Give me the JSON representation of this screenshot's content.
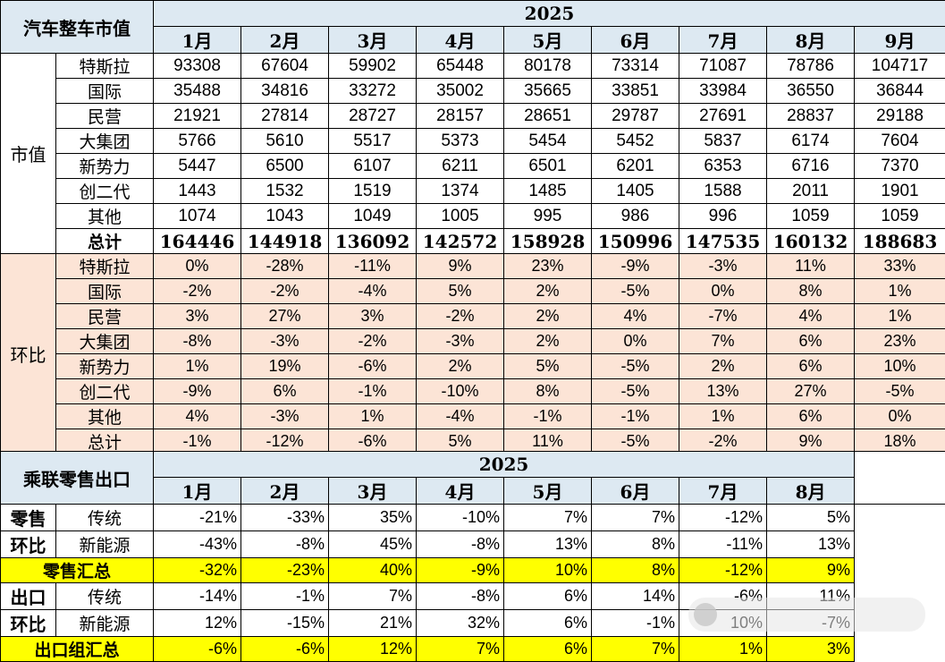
{
  "table1": {
    "title": "汽车整车市值",
    "year": "2025",
    "months": [
      "1月",
      "2月",
      "3月",
      "4月",
      "5月",
      "6月",
      "7月",
      "8月",
      "9月"
    ],
    "market_value": {
      "group_label": "市值",
      "rows": [
        {
          "label": "特斯拉",
          "values": [
            "93308",
            "67604",
            "59902",
            "65448",
            "80178",
            "73314",
            "71087",
            "78786",
            "104717"
          ]
        },
        {
          "label": "国际",
          "values": [
            "35488",
            "34816",
            "33272",
            "35002",
            "35665",
            "33851",
            "33984",
            "36550",
            "36844"
          ]
        },
        {
          "label": "民营",
          "values": [
            "21921",
            "27814",
            "28727",
            "28157",
            "28651",
            "29787",
            "27691",
            "28837",
            "29188"
          ]
        },
        {
          "label": "大集团",
          "values": [
            "5766",
            "5610",
            "5517",
            "5373",
            "5454",
            "5452",
            "5837",
            "6174",
            "7604"
          ]
        },
        {
          "label": "新势力",
          "values": [
            "5447",
            "6500",
            "6107",
            "6211",
            "6501",
            "6201",
            "6353",
            "6716",
            "7370"
          ]
        },
        {
          "label": "创二代",
          "values": [
            "1443",
            "1532",
            "1519",
            "1374",
            "1485",
            "1405",
            "1588",
            "2011",
            "1901"
          ]
        },
        {
          "label": "其他",
          "values": [
            "1074",
            "1043",
            "1049",
            "1005",
            "995",
            "986",
            "996",
            "1059",
            "1059"
          ]
        }
      ],
      "total": {
        "label": "总计",
        "values": [
          "164446",
          "144918",
          "136092",
          "142572",
          "158928",
          "150996",
          "147535",
          "160132",
          "188683"
        ]
      }
    },
    "mom": {
      "group_label": "环比",
      "rows": [
        {
          "label": "特斯拉",
          "values": [
            "0%",
            "-28%",
            "-11%",
            "9%",
            "23%",
            "-9%",
            "-3%",
            "11%",
            "33%"
          ]
        },
        {
          "label": "国际",
          "values": [
            "-2%",
            "-2%",
            "-4%",
            "5%",
            "2%",
            "-5%",
            "0%",
            "8%",
            "1%"
          ]
        },
        {
          "label": "民营",
          "values": [
            "3%",
            "27%",
            "3%",
            "-2%",
            "2%",
            "4%",
            "-7%",
            "4%",
            "1%"
          ]
        },
        {
          "label": "大集团",
          "values": [
            "-8%",
            "-3%",
            "-2%",
            "-3%",
            "2%",
            "0%",
            "7%",
            "6%",
            "23%"
          ]
        },
        {
          "label": "新势力",
          "values": [
            "1%",
            "19%",
            "-6%",
            "2%",
            "5%",
            "-5%",
            "2%",
            "6%",
            "10%"
          ]
        },
        {
          "label": "创二代",
          "values": [
            "-9%",
            "6%",
            "-1%",
            "-10%",
            "8%",
            "-5%",
            "13%",
            "27%",
            "-5%"
          ]
        },
        {
          "label": "其他",
          "values": [
            "4%",
            "-3%",
            "1%",
            "-4%",
            "-1%",
            "-1%",
            "1%",
            "6%",
            "0%"
          ]
        },
        {
          "label": "总计",
          "values": [
            "-1%",
            "-12%",
            "-6%",
            "5%",
            "11%",
            "-5%",
            "-2%",
            "9%",
            "18%"
          ]
        }
      ]
    }
  },
  "table2": {
    "title": "乘联零售出口",
    "year": "2025",
    "months": [
      "1月",
      "2月",
      "3月",
      "4月",
      "5月",
      "6月",
      "7月",
      "8月"
    ],
    "retail": {
      "group_label_1": "零售",
      "group_label_2": "环比",
      "rows": [
        {
          "label": "传统",
          "values": [
            "-21%",
            "-33%",
            "35%",
            "-10%",
            "7%",
            "7%",
            "-12%",
            "5%"
          ]
        },
        {
          "label": "新能源",
          "values": [
            "-43%",
            "-8%",
            "45%",
            "-8%",
            "13%",
            "8%",
            "-11%",
            "13%"
          ]
        }
      ],
      "total": {
        "label": "零售汇总",
        "values": [
          "-32%",
          "-23%",
          "40%",
          "-9%",
          "10%",
          "8%",
          "-12%",
          "9%"
        ]
      }
    },
    "export": {
      "group_label_1": "出口",
      "group_label_2": "环比",
      "rows": [
        {
          "label": "传统",
          "values": [
            "-14%",
            "-1%",
            "7%",
            "-8%",
            "6%",
            "14%",
            "-6%",
            "11%"
          ]
        },
        {
          "label": "新能源",
          "values": [
            "12%",
            "-15%",
            "21%",
            "32%",
            "6%",
            "-1%",
            "10%",
            "-7%"
          ]
        }
      ],
      "total": {
        "label": "出口组汇总",
        "values": [
          "-6%",
          "-6%",
          "12%",
          "7%",
          "6%",
          "7%",
          "1%",
          "3%"
        ]
      }
    }
  },
  "colors": {
    "header_bg": "#dde9f2",
    "mom_bg": "#fce4d6",
    "highlight": "#ffff00"
  }
}
